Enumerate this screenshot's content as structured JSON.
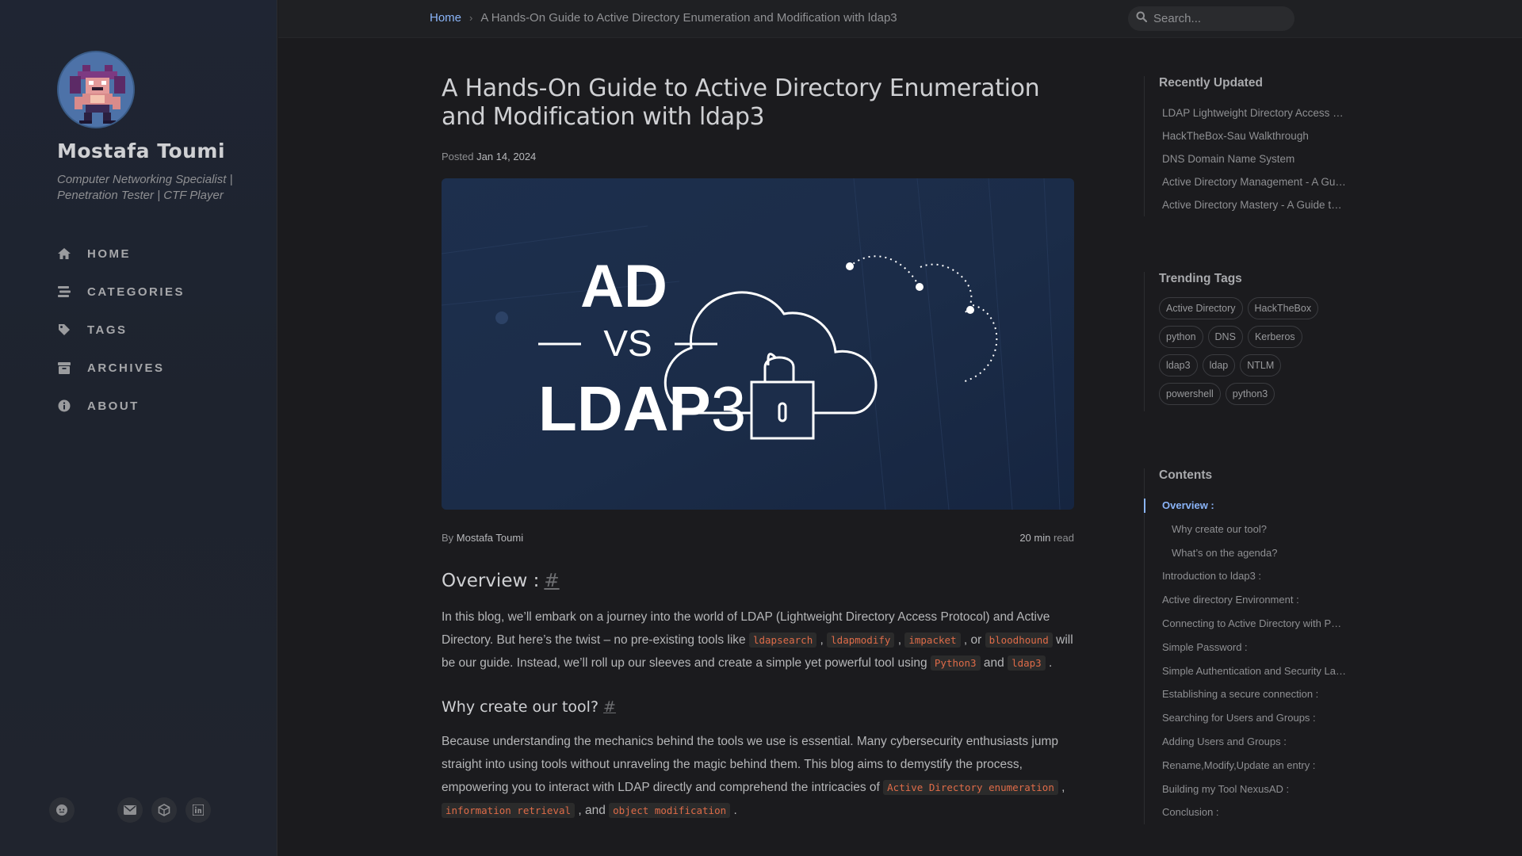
{
  "breadcrumb": {
    "home": "Home",
    "separator": "›",
    "current": "A Hands-On Guide to Active Directory Enumeration and Modification with ldap3"
  },
  "search": {
    "placeholder": "Search..."
  },
  "sidebar": {
    "title": "Mostafa Toumi",
    "subtitle": "Computer Networking Specialist | Penetration Tester | CTF Player",
    "nav": [
      {
        "label": "HOME",
        "icon": "home-icon"
      },
      {
        "label": "CATEGORIES",
        "icon": "stream-icon"
      },
      {
        "label": "TAGS",
        "icon": "tag-icon"
      },
      {
        "label": "ARCHIVES",
        "icon": "archive-icon"
      },
      {
        "label": "ABOUT",
        "icon": "info-circle-icon"
      }
    ],
    "social": [
      "github-icon",
      "email-icon",
      "hackthebox-icon",
      "linkedin-icon"
    ]
  },
  "post": {
    "title": "A Hands-On Guide to Active Directory Enumeration and Modification with ldap3",
    "posted_label": "Posted",
    "date": "Jan 14, 2024",
    "banner": {
      "line1": "AD",
      "line2": "VS",
      "line3": "LDAP",
      "line3_suffix": "3"
    },
    "by_label": "By",
    "author": "Mostafa Toumi",
    "read_min": "20 min",
    "read_label": "read",
    "overview_heading": "Overview :",
    "overview_p": {
      "t1": "In this blog, we’ll embark on a journey into the world of LDAP (Lightweight Directory Access Protocol) and Active Directory. But here’s the twist – no pre-existing tools like ",
      "c1": "ldapsearch",
      "t2": " , ",
      "c2": "ldapmodify",
      "t3": " , ",
      "c3": "impacket",
      "t4": " , or ",
      "c4": "bloodhound",
      "t5": " will be our guide. Instead, we’ll roll up our sleeves and create a simple yet powerful tool using ",
      "c5": "Python3",
      "t6": " and ",
      "c6": "ldap3",
      "t7": " ."
    },
    "why_heading": "Why create our tool?",
    "why_p": {
      "t1": "Because understanding the mechanics behind the tools we use is essential. Many cybersecurity enthusiasts jump straight into using tools without unraveling the magic behind them. This blog aims to demystify the process, empowering you to interact with LDAP directly and comprehend the intricacies of ",
      "c1": "Active Directory enumeration",
      "t2": " , ",
      "c2": "information retrieval",
      "t3": " , and ",
      "c3": "object modification",
      "t4": " ."
    },
    "anchor": "#"
  },
  "panel": {
    "recent_heading": "Recently Updated",
    "recent": [
      "LDAP Lightweight Directory Access Protocol",
      "HackTheBox-Sau Walkthrough",
      "DNS Domain Name System",
      "Active Directory Management - A Guide",
      "Active Directory Mastery - A Guide to Enumeration"
    ],
    "trending_heading": "Trending Tags",
    "tags": [
      "Active Directory",
      "HackTheBox",
      "python",
      "DNS",
      "Kerberos",
      "ldap3",
      "ldap",
      "NTLM",
      "powershell",
      "python3"
    ],
    "toc_heading": "Contents",
    "toc": [
      {
        "label": "Overview :",
        "sub": false,
        "active": true
      },
      {
        "label": "Why create our tool?",
        "sub": true,
        "active": false
      },
      {
        "label": "What’s on the agenda?",
        "sub": true,
        "active": false
      },
      {
        "label": "Introduction to ldap3 :",
        "sub": false,
        "active": false
      },
      {
        "label": "Active directory Environment :",
        "sub": false,
        "active": false
      },
      {
        "label": "Connecting to Active Directory with Python :",
        "sub": false,
        "active": false
      },
      {
        "label": "Simple Password :",
        "sub": false,
        "active": false
      },
      {
        "label": "Simple Authentication and Security Layer :",
        "sub": false,
        "active": false
      },
      {
        "label": "Establishing a secure connection :",
        "sub": false,
        "active": false
      },
      {
        "label": "Searching for Users and Groups :",
        "sub": false,
        "active": false
      },
      {
        "label": "Adding Users and Groups :",
        "sub": false,
        "active": false
      },
      {
        "label": "Rename,Modify,Update an entry :",
        "sub": false,
        "active": false
      },
      {
        "label": "Building my Tool NexusAD :",
        "sub": false,
        "active": false
      },
      {
        "label": "Conclusion :",
        "sub": false,
        "active": false
      }
    ]
  },
  "colors": {
    "accent": "#8ab4f8",
    "code": "#de6b48",
    "background": "#1b1b1e",
    "sidebar": "#1f2533"
  }
}
